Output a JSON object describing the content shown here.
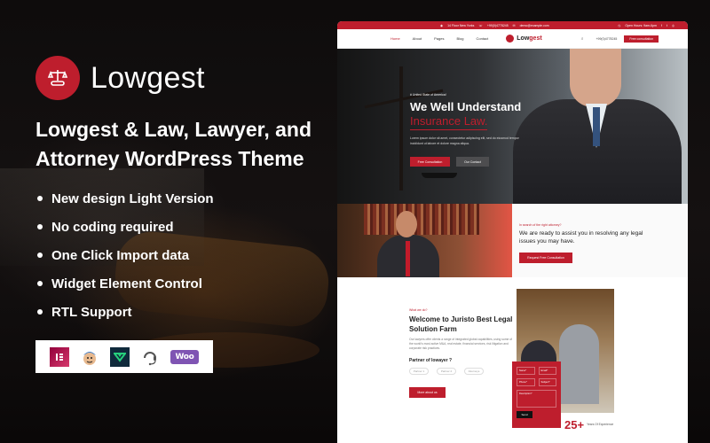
{
  "brand": {
    "name": "Lowgest",
    "logo_icon": "scales-of-justice-icon",
    "accent_color": "#be1e2d"
  },
  "headline": "Lowgest & Law, Lawyer, and Attorney WordPress Theme",
  "features": [
    "New design Light Version",
    "No coding required",
    "One Click Import data",
    "Widget Element Control",
    "RTL Support"
  ],
  "plugins": [
    {
      "name": "Elementor",
      "icon": "elementor-icon"
    },
    {
      "name": "Mailchimp",
      "icon": "mailchimp-icon"
    },
    {
      "name": "Slider Revolution",
      "icon": "slider-revolution-icon"
    },
    {
      "name": "Support",
      "icon": "headset-icon"
    },
    {
      "name": "WooCommerce",
      "icon": "woocommerce-icon",
      "label": "Woo"
    }
  ],
  "preview": {
    "topbar": {
      "address": "14 Floor New Yorks",
      "phone": "+99(0)4778245",
      "email": "demo@example.com",
      "hours": "Open Hours: 9am-6pm",
      "social": [
        "facebook-icon",
        "twitter-icon",
        "instagram-icon"
      ]
    },
    "nav": {
      "items": [
        "Home",
        "About",
        "Pages",
        "Blog",
        "Contact"
      ],
      "active": "Home",
      "logo_text_1": "Low",
      "logo_text_2": "gest",
      "phone": "+99(0)4778245",
      "cta": "Free consultation"
    },
    "hero": {
      "tag": "# United State of America!",
      "title_1": "We Well Understand",
      "title_2": "Insurance Law.",
      "text": "Lorem ipsum dolor sit amet, consectetur adipiscing elit, sed do eiusmod tempor incididunt ut labore et dolore magna aliqua.",
      "btn_primary": "Free Consultation",
      "btn_secondary": "Our Contact"
    },
    "cta": {
      "tag": "In search of the right attorney?",
      "heading": "We are ready to assist you in resolving any legal issues you may have.",
      "button": "Request Free Consultation"
    },
    "about": {
      "tag": "What we do?",
      "heading": "Welcome to Juristo Best Legal Solution Farm",
      "text": "Our lawyers offer clients a range of integrated global capabilities, using some of the world's most active M&A, real estate, financial services, risk litigation and corporate risk practices.",
      "partner_heading": "Partner of lowayer ?",
      "partners": [
        "Partner 1",
        "Partner 2",
        "Attorneys"
      ],
      "button": "More about us"
    },
    "form": {
      "fields": [
        "Name*",
        "Email*",
        "Phone*",
        "Subject*",
        "Description*"
      ],
      "submit": "Send"
    },
    "experience": {
      "number": "25+",
      "label": "Years Of Experience"
    }
  }
}
